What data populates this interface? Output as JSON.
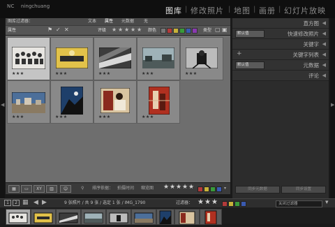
{
  "header": {
    "brand_prefix": "NC",
    "user": "ningchuang",
    "modules": [
      {
        "label": "图库",
        "active": true
      },
      {
        "label": "修改照片",
        "active": false
      },
      {
        "label": "地图",
        "active": false
      },
      {
        "label": "画册",
        "active": false
      },
      {
        "label": "幻灯片放映",
        "active": false
      }
    ],
    "separator": "|"
  },
  "filter_bar": {
    "left_label": "图库过滤器：",
    "tabs": [
      "文本",
      "属性",
      "元数据",
      "无"
    ],
    "attribute_label": "属性",
    "rating_label": "评级",
    "color_label": "颜色",
    "type_label": "类型",
    "stars": [
      "★",
      "★",
      "★",
      "★",
      "★"
    ],
    "swatch_colors": [
      "#777777",
      "#b23a3a",
      "#c7b23a",
      "#3a9a3a",
      "#3a5ab0",
      "#8a3ab0"
    ]
  },
  "grid": {
    "items": [
      {
        "stars": "★★★",
        "selected": true
      },
      {
        "stars": "★★★",
        "selected": false
      },
      {
        "stars": "★★★",
        "selected": false
      },
      {
        "stars": "★★★",
        "selected": false
      },
      {
        "stars": "★★★",
        "selected": false
      },
      {
        "stars": "★★★",
        "selected": false
      },
      {
        "stars": "★★★",
        "selected": false
      },
      {
        "stars": "★★★",
        "selected": false
      },
      {
        "stars": "★★★",
        "selected": false
      }
    ]
  },
  "toolbar": {
    "sort_label": "排序依据：",
    "sort_value": "拍摄时间",
    "thumb_label": "缩览图",
    "stars": [
      "★",
      "★",
      "★",
      "★",
      "★"
    ],
    "swatch_colors": [
      "#b23a3a",
      "#c7b23a",
      "#3a9a3a",
      "#3a5ab0"
    ]
  },
  "right_panel": {
    "rows": [
      {
        "label": "直方图",
        "select": "",
        "plus": false
      },
      {
        "label": "快速修改照片",
        "select": "默认值",
        "plus": false
      },
      {
        "label": "关键字",
        "select": "",
        "plus": false
      },
      {
        "label": "关键字列表",
        "select": "",
        "plus": true
      },
      {
        "label": "元数据",
        "select": "默认值",
        "plus": false
      },
      {
        "label": "评论",
        "select": "",
        "plus": false
      }
    ],
    "sync_metadata": "同步元数据",
    "sync_settings": "同步设置"
  },
  "filmstrip_header": {
    "page1": "1",
    "page2": "2",
    "source_text": "9 张照片 / 共 9 张 / 选定 1 张 / IMG_1790",
    "filter_label": "过滤器：",
    "filter_value": "关闭过滤器",
    "stars": [
      "★",
      "★",
      "★"
    ],
    "swatch_colors": [
      "#b23a3a",
      "#c7b23a",
      "#3a9a3a",
      "#3a5ab0"
    ]
  }
}
